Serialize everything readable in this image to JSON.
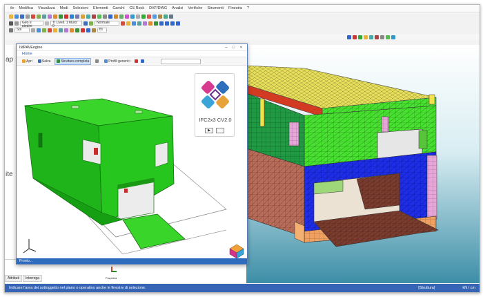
{
  "app": {
    "menus": [
      "ile",
      "Modifica",
      "Visualizza",
      "Modi",
      "Selezioni",
      "Elementi",
      "Carichi",
      "CS Rock",
      "DXF/DWG",
      "Analisi",
      "Verifiche",
      "Strumenti",
      "Finestra",
      "?"
    ],
    "toolbar": {
      "combo_view": "Geo e piedini",
      "combo_level": "Tl Livell. 1 Muro: 0",
      "combo_mode": "Normale",
      "combo_zoom": "Sol",
      "combo_extra": "BI"
    },
    "left_panel_text_1": "ap",
    "left_panel_text_2": "ite",
    "bottom_tabs": [
      "Attributi",
      "Interroga"
    ],
    "bottom_icon_label": "Proprietà",
    "status_left": "Indicare l'area dei sottoggetto nel piano o operativo anche le finestre di selezione.",
    "status_mid": "[Struttura]",
    "status_right": "kN / cm"
  },
  "dialog": {
    "title": "IMPAVEngine",
    "tab": "Home",
    "ribbon": {
      "open": "Apri",
      "save": "Salva",
      "structure": "Struttura completa",
      "profiles": "Profili generici"
    },
    "ifc_label": "IFC2x3 CV2.0",
    "footer": "Pronto..."
  },
  "colors": {
    "status_bar": "#3565b4",
    "accent": "#2f6bbd",
    "model_green": "#22c21d"
  }
}
